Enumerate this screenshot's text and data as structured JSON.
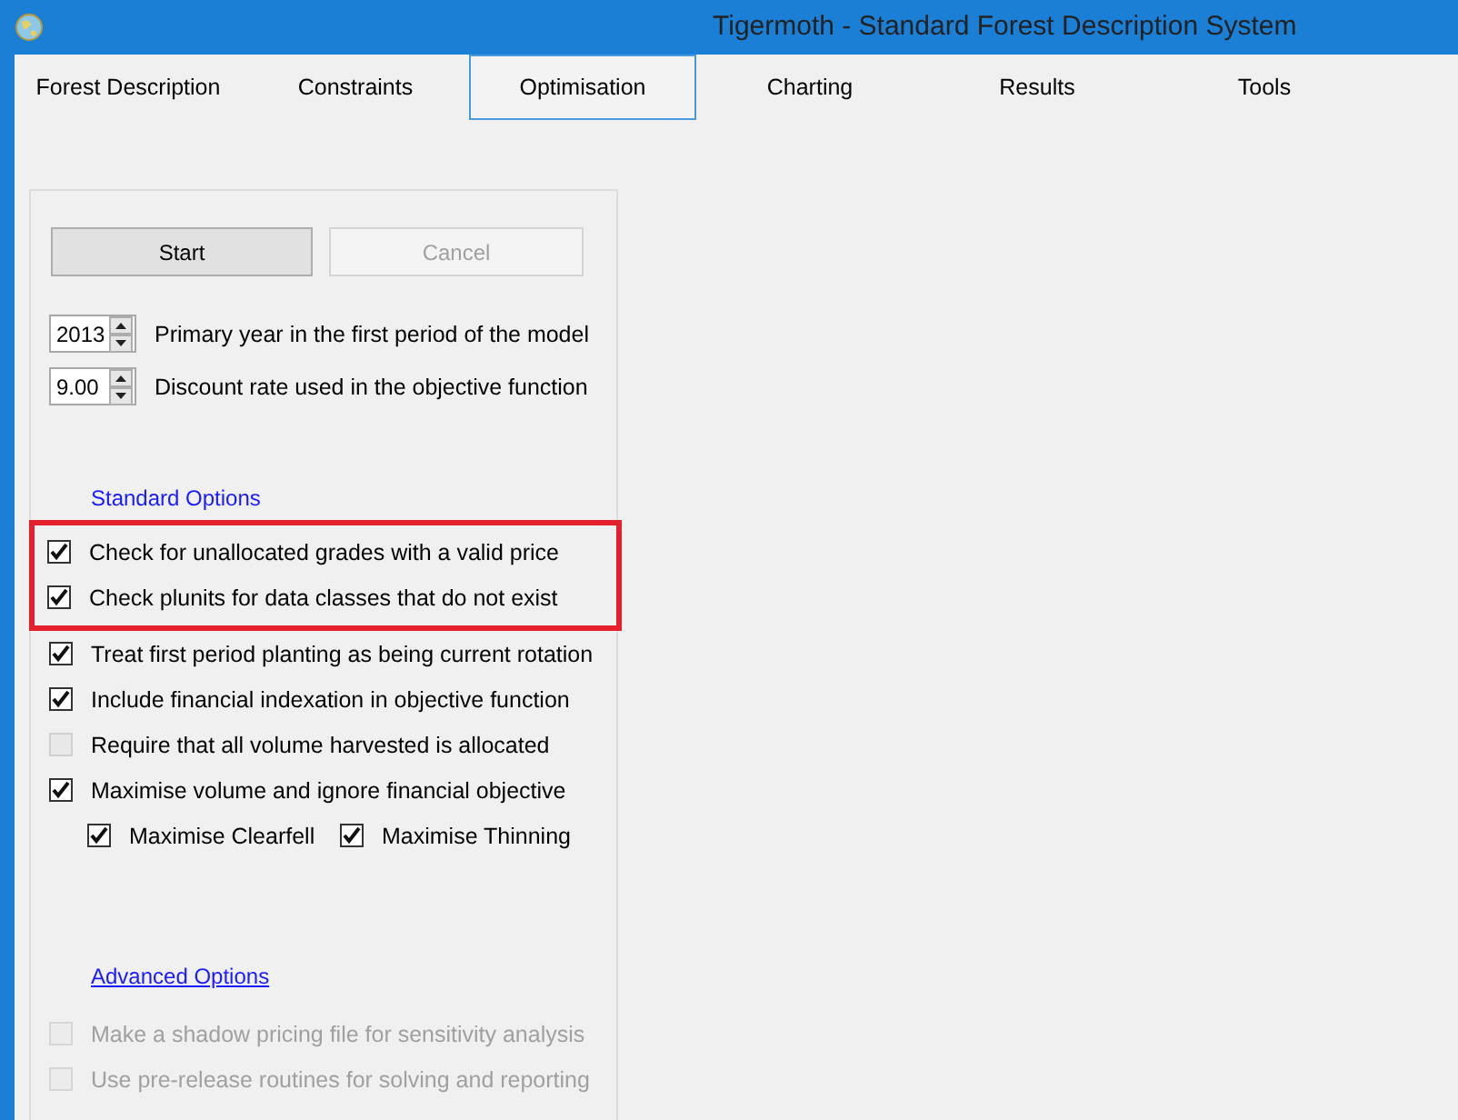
{
  "window": {
    "title": "Tigermoth - Standard Forest Description System"
  },
  "tabs": [
    {
      "label": "Forest Description",
      "selected": false
    },
    {
      "label": "Constraints",
      "selected": false
    },
    {
      "label": "Optimisation",
      "selected": true
    },
    {
      "label": "Charting",
      "selected": false
    },
    {
      "label": "Results",
      "selected": false
    },
    {
      "label": "Tools",
      "selected": false
    }
  ],
  "buttons": [
    {
      "label": "Start",
      "disabled": false
    },
    {
      "label": "Cancel",
      "disabled": true
    }
  ],
  "spinners": [
    {
      "value": "2013",
      "label": "Primary year in the first period of the model"
    },
    {
      "value": "9.00",
      "label": "Discount rate used in the objective function"
    }
  ],
  "standard_options": {
    "link": "Standard Options",
    "items": [
      {
        "label": "Check for unallocated grades with a valid price",
        "checked": true,
        "highlighted": true
      },
      {
        "label": "Check plunits for data classes that do not exist",
        "checked": true,
        "highlighted": true
      },
      {
        "label": "Treat first period planting as being current rotation",
        "checked": true,
        "highlighted": false
      },
      {
        "label": "Include financial indexation in objective function",
        "checked": true,
        "highlighted": false
      },
      {
        "label": "Require that all volume harvested is allocated",
        "checked": false,
        "highlighted": false
      },
      {
        "label": "Maximise volume and ignore financial objective",
        "checked": true,
        "highlighted": false,
        "children": [
          {
            "label": "Maximise Clearfell",
            "checked": true
          },
          {
            "label": "Maximise Thinning",
            "checked": true
          }
        ]
      }
    ]
  },
  "advanced_options": {
    "link": "Advanced Options",
    "items": [
      {
        "label": "Make a shadow pricing file for sensitivity analysis",
        "checked": false,
        "disabled": true
      },
      {
        "label": "Use pre-release routines for solving and reporting",
        "checked": false,
        "disabled": true
      }
    ]
  }
}
